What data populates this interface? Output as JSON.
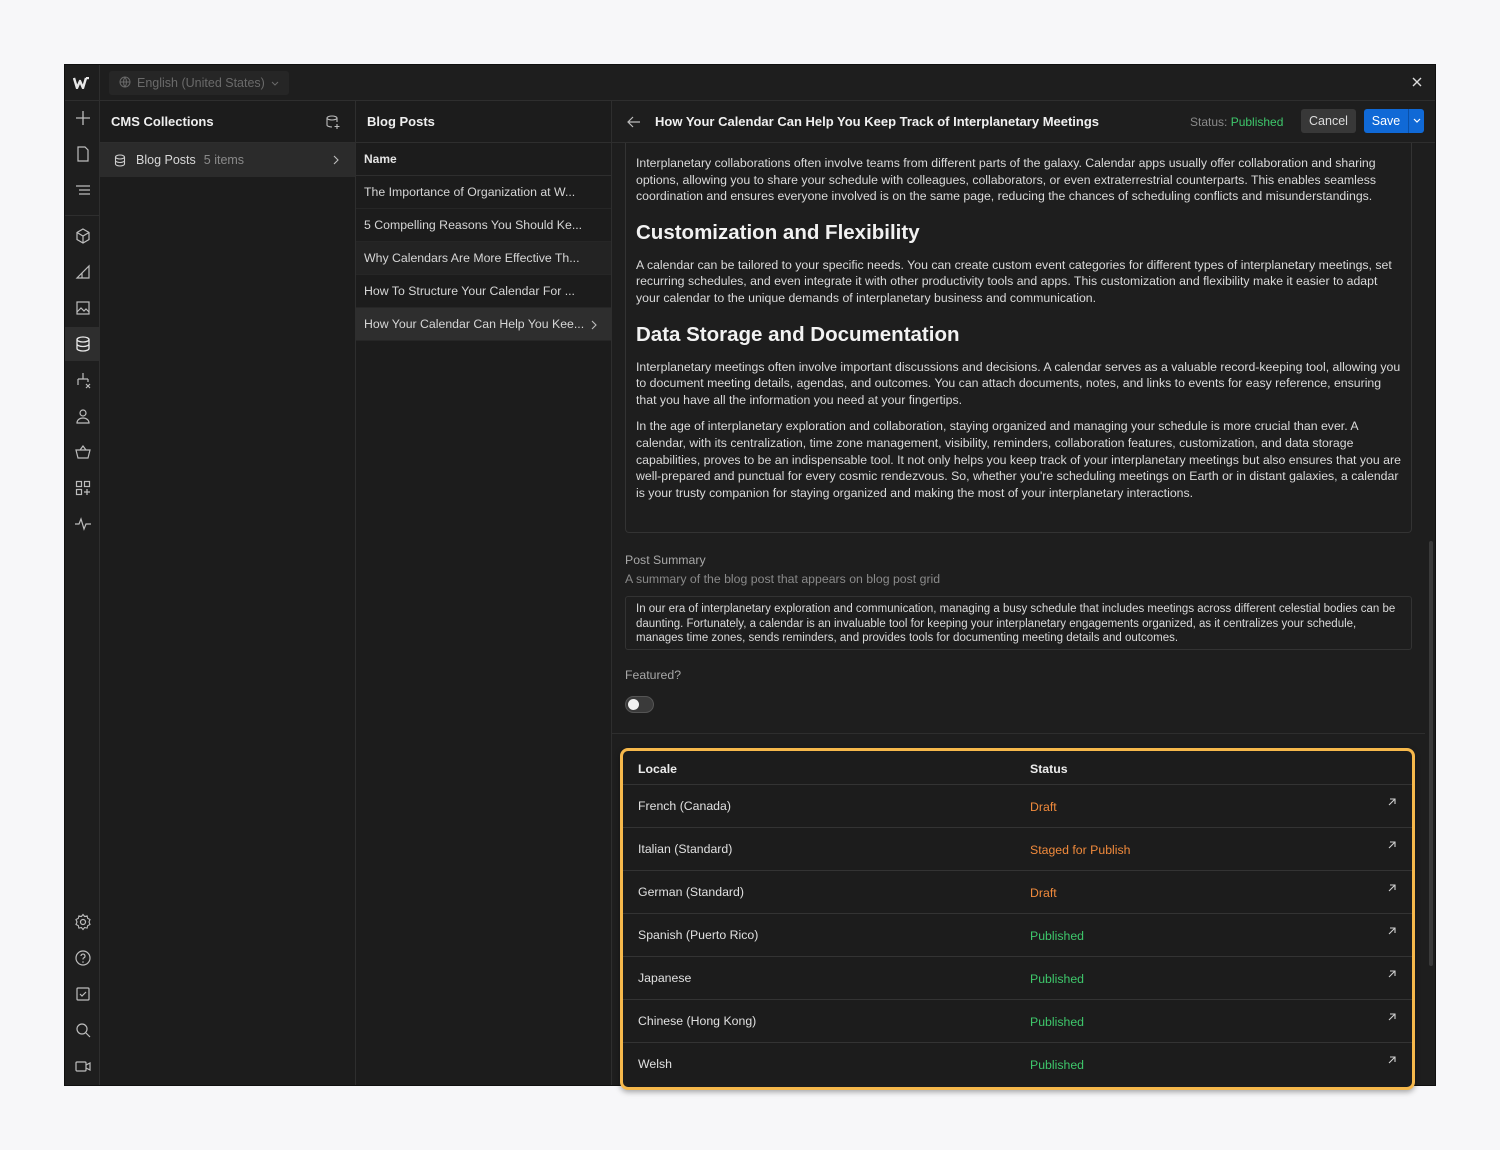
{
  "topbar": {
    "locale": "English (United States)"
  },
  "cms": {
    "title": "CMS Collections",
    "collection": {
      "name": "Blog Posts",
      "count": "5 items"
    }
  },
  "posts_panel": {
    "title": "Blog Posts",
    "column": "Name",
    "items": [
      "The Importance of Organization at W...",
      "5 Compelling Reasons You Should Ke...",
      "Why Calendars Are More Effective Th...",
      "How To Structure Your Calendar For ...",
      "How Your Calendar Can Help You Kee..."
    ]
  },
  "editor": {
    "title": "How Your Calendar Can Help You Keep Track of Interplanetary Meetings",
    "status_label": "Status:",
    "status_value": "Published",
    "cancel": "Cancel",
    "save": "Save",
    "body": {
      "p1": "Interplanetary collaborations often involve teams from different parts of the galaxy. Calendar apps usually offer collaboration and sharing options, allowing you to share your schedule with colleagues, collaborators, or even extraterrestrial counterparts. This enables seamless coordination and ensures everyone involved is on the same page, reducing the chances of scheduling conflicts and misunderstandings.",
      "h2a": "Customization and Flexibility",
      "p2": "A calendar can be tailored to your specific needs. You can create custom event categories for different types of interplanetary meetings, set recurring schedules, and even integrate it with other productivity tools and apps. This customization and flexibility make it easier to adapt your calendar to the unique demands of interplanetary business and communication.",
      "h2b": "Data Storage and Documentation",
      "p3": "Interplanetary meetings often involve important discussions and decisions. A calendar serves as a valuable record-keeping tool, allowing you to document meeting details, agendas, and outcomes. You can attach documents, notes, and links to events for easy reference, ensuring that you have all the information you need at your fingertips.",
      "p4": "In the age of interplanetary exploration and collaboration, staying organized and managing your schedule is more crucial than ever. A calendar, with its centralization, time zone management, visibility, reminders, collaboration features, customization, and data storage capabilities, proves to be an indispensable tool. It not only helps you keep track of your interplanetary meetings but also ensures that you are well-prepared and punctual for every cosmic rendezvous. So, whether you're scheduling meetings on Earth or in distant galaxies, a calendar is your trusty companion for staying organized and making the most of your interplanetary interactions."
    },
    "summary_label": "Post Summary",
    "summary_help": "A summary of the blog post that appears on blog post grid",
    "summary_value": "In our era of interplanetary exploration and communication, managing a busy schedule that includes meetings across different celestial bodies can be daunting. Fortunately, a calendar is an invaluable tool for keeping your interplanetary engagements organized, as it centralizes your schedule, manages time zones, sends reminders, and provides tools for documenting meeting details and outcomes.",
    "featured_label": "Featured?",
    "featured": false
  },
  "locales": {
    "col_locale": "Locale",
    "col_status": "Status",
    "rows": [
      {
        "locale": "French (Canada)",
        "status": "Draft",
        "color": "#f08a3c"
      },
      {
        "locale": "Italian (Standard)",
        "status": "Staged for Publish",
        "color": "#f08a3c"
      },
      {
        "locale": "German (Standard)",
        "status": "Draft",
        "color": "#f08a3c"
      },
      {
        "locale": "Spanish (Puerto Rico)",
        "status": "Published",
        "color": "#3ec76b"
      },
      {
        "locale": "Japanese",
        "status": "Published",
        "color": "#3ec76b"
      },
      {
        "locale": "Chinese (Hong Kong)",
        "status": "Published",
        "color": "#3ec76b"
      },
      {
        "locale": "Welsh",
        "status": "Published",
        "color": "#3ec76b"
      }
    ]
  },
  "colors": {
    "accent": "#1069d6",
    "highlight": "#f6b84b",
    "published": "#3ec76b",
    "draft": "#f08a3c"
  }
}
